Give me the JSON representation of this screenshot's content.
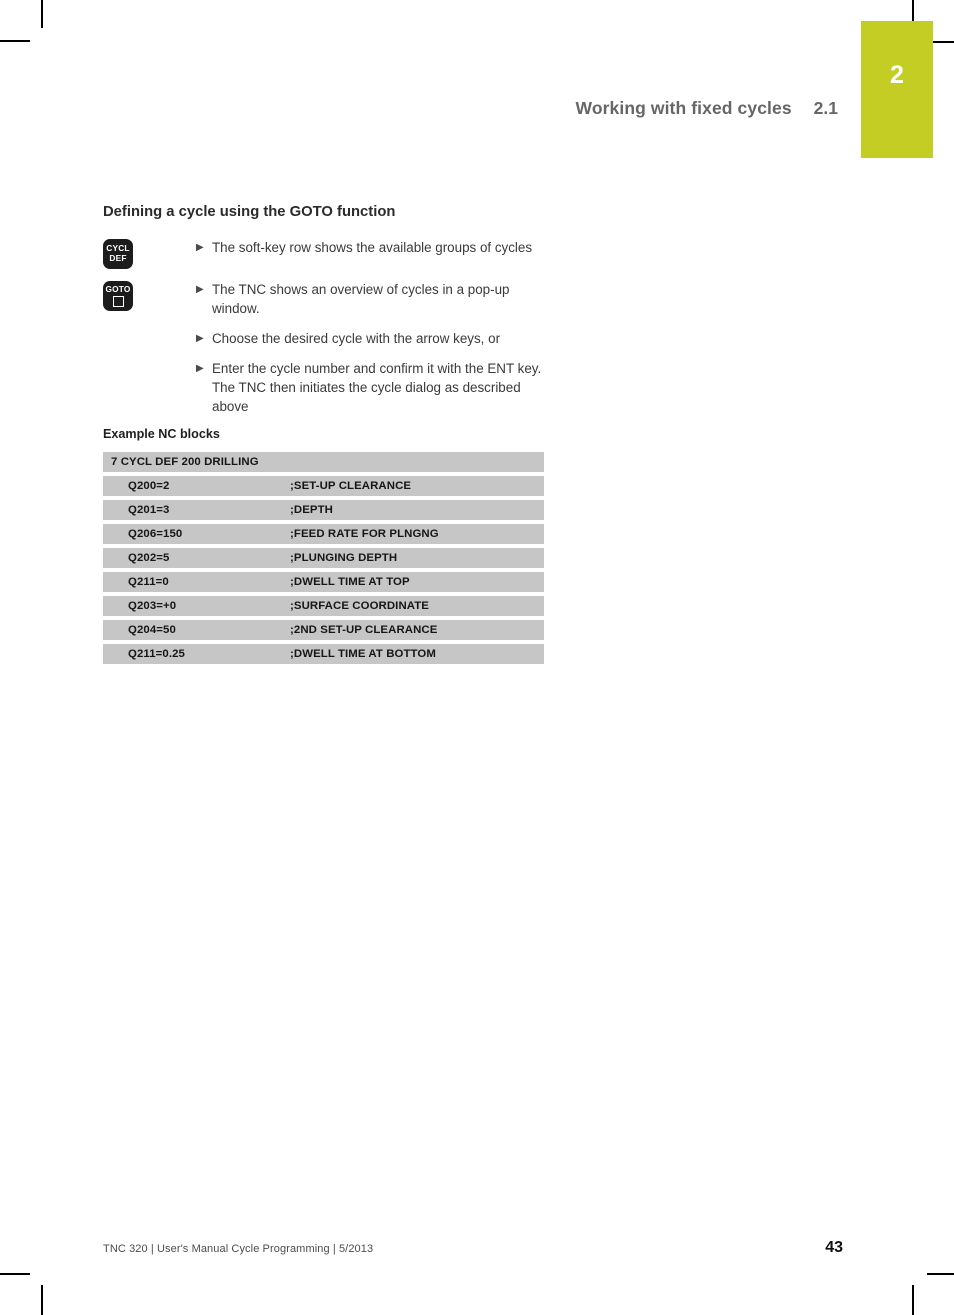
{
  "chapter_tab": {
    "number": "2",
    "color": "#c3cd23"
  },
  "running_head": {
    "title": "Working with fixed cycles",
    "section": "2.1"
  },
  "section": {
    "heading": "Defining a cycle using the GOTO function"
  },
  "keys": [
    {
      "name": "cycl-def-key",
      "line1": "CYCL",
      "line2": "DEF"
    },
    {
      "name": "goto-key",
      "line1": "GOTO",
      "line2": ""
    }
  ],
  "steps": [
    {
      "bullet": "▶",
      "text": "The soft-key row shows the available groups of cycles"
    },
    {
      "bullet": "▶",
      "text": "The TNC shows an overview of cycles in a pop-up window."
    },
    {
      "bullet": "▶",
      "text": "Choose the desired cycle with the arrow keys, or"
    },
    {
      "bullet": "▶",
      "text": "Enter the cycle number and confirm it with the ENT key. The TNC then initiates the cycle dialog as described above"
    }
  ],
  "example": {
    "label": "Example NC blocks",
    "header_row": "7 CYCL DEF 200 DRILLING",
    "rows": [
      {
        "param": "Q200=2",
        "comment": ";SET-UP CLEARANCE"
      },
      {
        "param": "Q201=3",
        "comment": ";DEPTH"
      },
      {
        "param": "Q206=150",
        "comment": ";FEED RATE FOR PLNGNG"
      },
      {
        "param": "Q202=5",
        "comment": ";PLUNGING DEPTH"
      },
      {
        "param": "Q211=0",
        "comment": ";DWELL TIME AT TOP"
      },
      {
        "param": "Q203=+0",
        "comment": ";SURFACE COORDINATE"
      },
      {
        "param": "Q204=50",
        "comment": ";2ND SET-UP CLEARANCE"
      },
      {
        "param": "Q211=0.25",
        "comment": ";DWELL TIME AT BOTTOM"
      }
    ]
  },
  "footer": {
    "text": "TNC 320 | User's Manual Cycle Programming | 5/2013",
    "page": "43"
  }
}
